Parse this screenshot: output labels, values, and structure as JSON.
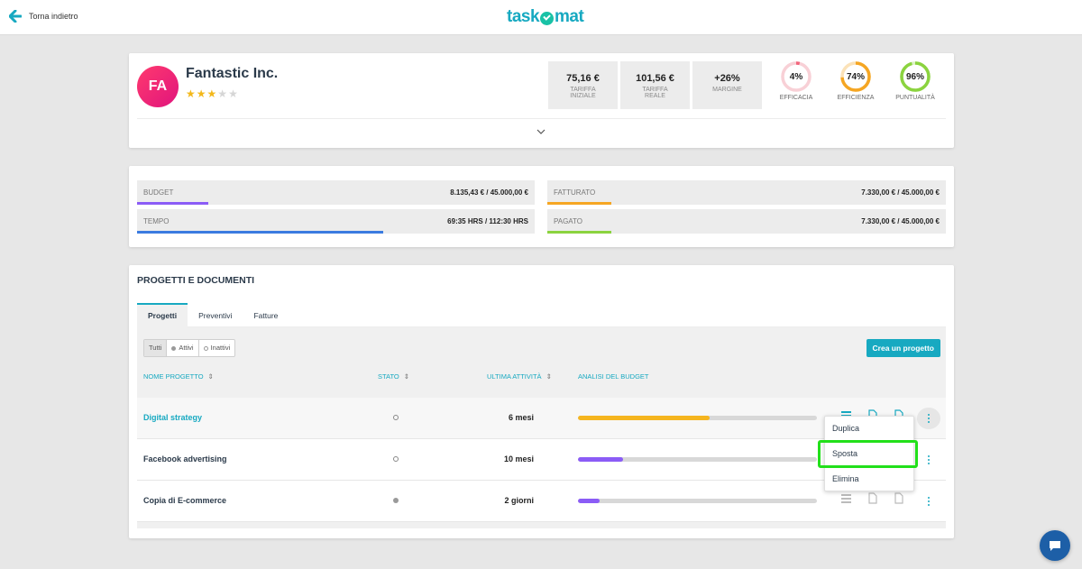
{
  "topbar": {
    "back_label": "Torna indietro",
    "logo_left": "task",
    "logo_right": "mat"
  },
  "client": {
    "initials": "FA",
    "name": "Fantastic Inc.",
    "rating": 3,
    "rating_max": 5,
    "kpis": [
      {
        "value": "75,16 €",
        "label": "TARIFFA INIZIALE"
      },
      {
        "value": "101,56 €",
        "label": "TARIFFA REALE"
      },
      {
        "value": "+26%",
        "label": "MARGINE"
      }
    ],
    "gauges": [
      {
        "value": "4%",
        "label": "EFFICACIA",
        "fraction": 0.04,
        "color": "#f2647b",
        "track": "#f8d0d6"
      },
      {
        "value": "74%",
        "label": "EFFICIENZA",
        "fraction": 0.74,
        "color": "#f5a623",
        "track": "#fbe2b8"
      },
      {
        "value": "96%",
        "label": "PUNTUALITÀ",
        "fraction": 0.96,
        "color": "#8bd33f",
        "track": "#dcf2c4"
      }
    ]
  },
  "meters": {
    "budget": {
      "label": "BUDGET",
      "value": "8.135,43 € / 45.000,00 €",
      "fraction": 0.18,
      "color": "#8b5cf6"
    },
    "tempo": {
      "label": "TEMPO",
      "value": "69:35 HRS / 112:30 HRS",
      "fraction": 0.62,
      "color": "#3b7be0"
    },
    "fatturato": {
      "label": "FATTURATO",
      "value": "7.330,00 € / 45.000,00 €",
      "fraction": 0.16,
      "color": "#f5a623"
    },
    "pagato": {
      "label": "PAGATO",
      "value": "7.330,00 € / 45.000,00 €",
      "fraction": 0.16,
      "color": "#8bd33f"
    }
  },
  "projects": {
    "title": "PROGETTI E DOCUMENTI",
    "tabs": [
      "Progetti",
      "Preventivi",
      "Fatture"
    ],
    "filters": [
      "Tutti",
      "Attivi",
      "Inattivi"
    ],
    "create_label": "Crea un progetto",
    "columns": {
      "name": "NOME PROGETTO",
      "stato": "STATO",
      "last": "ULTIMA ATTIVITÀ",
      "budget": "ANALISI DEL BUDGET"
    },
    "rows": [
      {
        "name": "Digital strategy",
        "stato": "inactive",
        "last": "6 mesi",
        "budget_fraction": 0.55,
        "budget_color": "#f5b51f"
      },
      {
        "name": "Facebook advertising",
        "stato": "inactive",
        "last": "10 mesi",
        "budget_fraction": 0.19,
        "budget_color": "#8b5cf6"
      },
      {
        "name": "Copia di E-commerce",
        "stato": "active",
        "last": "2 giorni",
        "budget_fraction": 0.09,
        "budget_color": "#8b5cf6"
      }
    ],
    "menu": [
      "Duplica",
      "Sposta",
      "Elimina"
    ]
  }
}
